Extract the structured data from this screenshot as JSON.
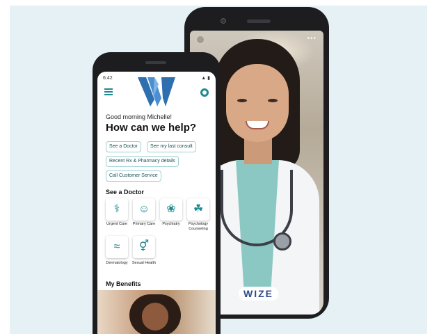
{
  "app": {
    "brand_badge": "WIZE",
    "status_time": "6:42",
    "status_icons": "▲ ▮",
    "greeting": "Good morning Michelle!",
    "headline": "How can we help?",
    "quick_actions": [
      {
        "label": "See a Doctor"
      },
      {
        "label": "See my last consult"
      },
      {
        "label": "Recent Rx & Pharmacy details"
      },
      {
        "label": "Call Customer Service"
      }
    ],
    "see_doctor_title": "See a Doctor",
    "services": [
      {
        "label": "Urgent Care",
        "icon": "urgent-care-icon",
        "glyph": "⚕"
      },
      {
        "label": "Primary Care",
        "icon": "primary-care-icon",
        "glyph": "☺"
      },
      {
        "label": "Psychiatry",
        "icon": "psychiatry-icon",
        "glyph": "❀"
      },
      {
        "label": "Psychology Counseling",
        "icon": "counseling-icon",
        "glyph": "☘"
      },
      {
        "label": "Dermatology",
        "icon": "dermatology-icon",
        "glyph": "≈"
      },
      {
        "label": "Sexual Health",
        "icon": "sexual-health-icon",
        "glyph": "⚥"
      }
    ],
    "benefits_title": "My Benefits",
    "video_menu": "•••"
  },
  "colors": {
    "accent": "#1f8a92",
    "logo_blue": "#2e6fb0",
    "background": "#e6f1f5",
    "badge_text": "#2e4a8a"
  }
}
